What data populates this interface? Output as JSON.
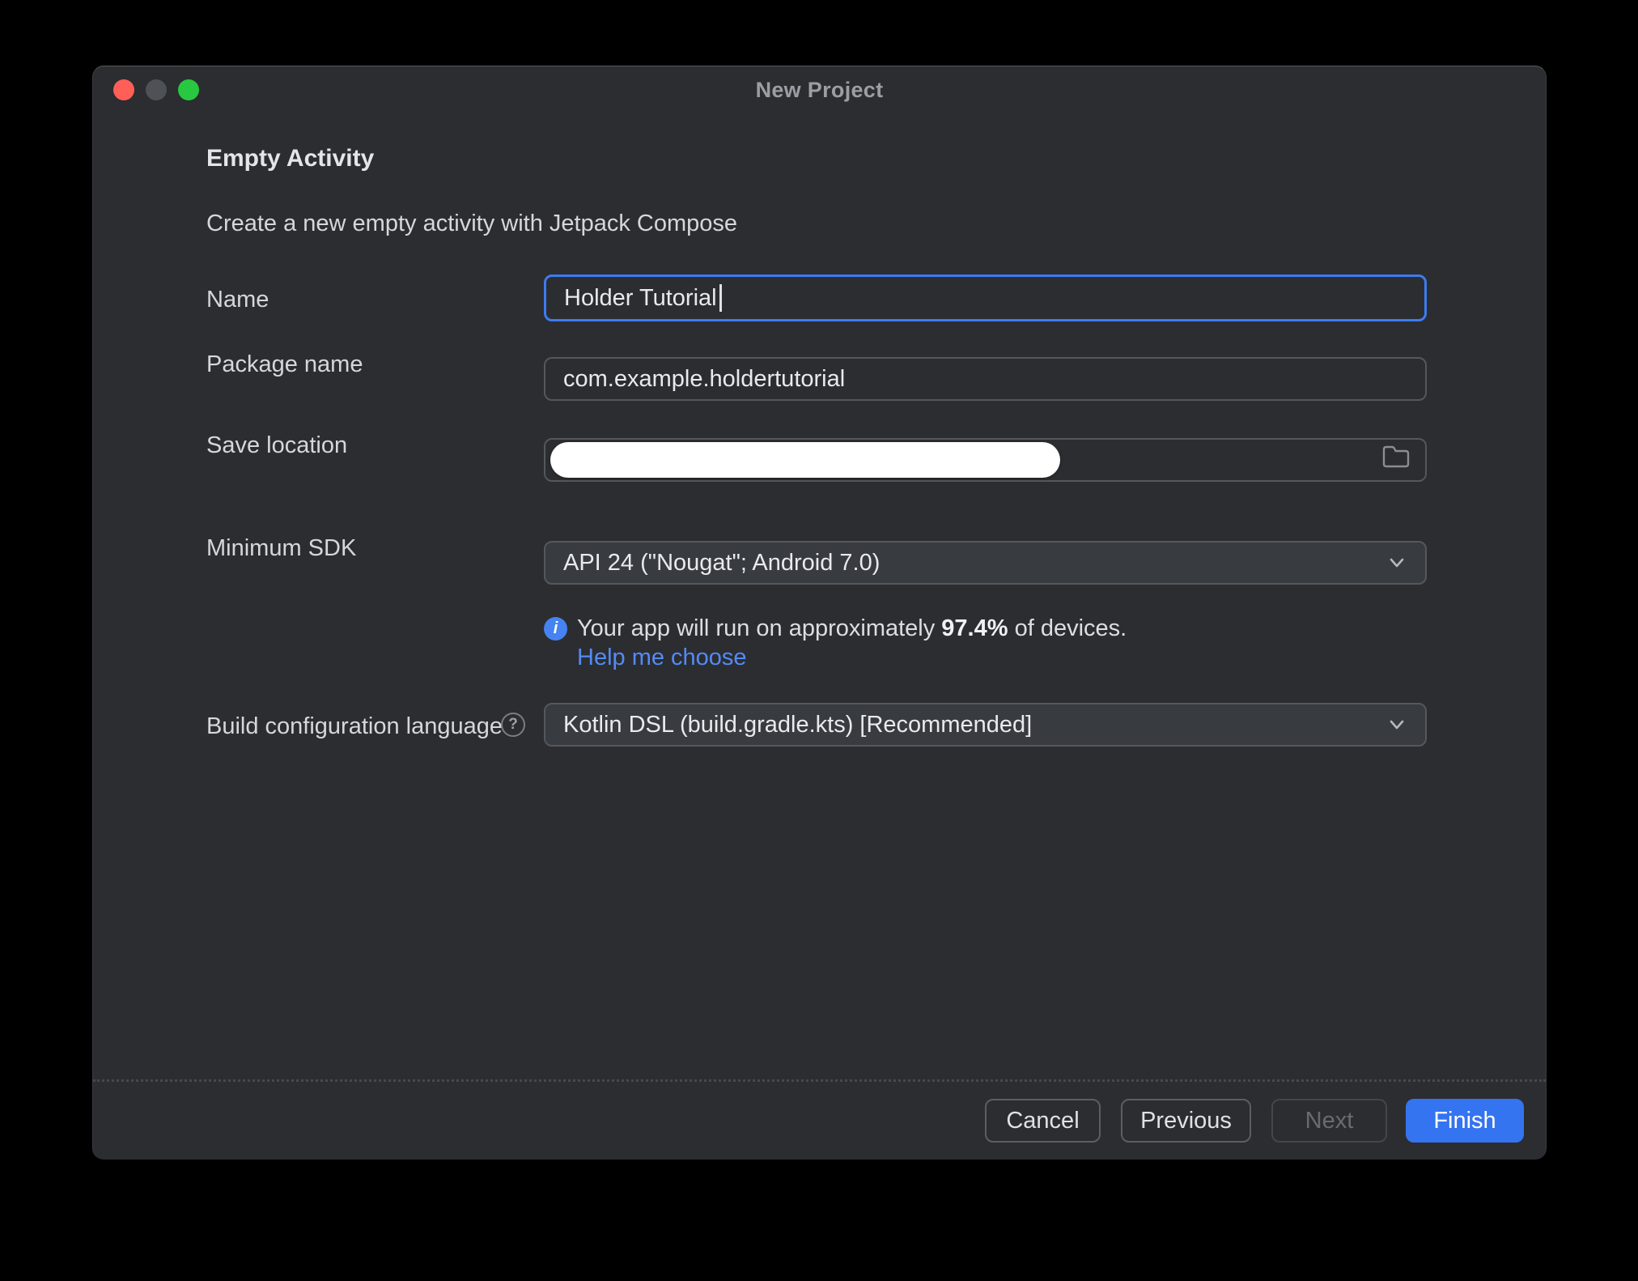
{
  "window": {
    "title": "New Project"
  },
  "content": {
    "heading": "Empty Activity",
    "subtitle": "Create a new empty activity with Jetpack Compose"
  },
  "fields": {
    "name": {
      "label": "Name",
      "value": "Holder Tutorial"
    },
    "package_name": {
      "label": "Package name",
      "value": "com.example.holdertutorial"
    },
    "save_location": {
      "label": "Save location",
      "value": ""
    },
    "minimum_sdk": {
      "label": "Minimum SDK",
      "selected": "API 24 (\"Nougat\"; Android 7.0)"
    },
    "build_config": {
      "label": "Build configuration language",
      "selected": "Kotlin DSL (build.gradle.kts) [Recommended]"
    }
  },
  "sdk_note": {
    "text_prefix": "Your app will run on approximately ",
    "percentage": "97.4%",
    "text_suffix": " of devices.",
    "link": "Help me choose"
  },
  "footer": {
    "cancel": "Cancel",
    "previous": "Previous",
    "next": "Next",
    "finish": "Finish"
  },
  "icons": {
    "info_glyph": "i",
    "help_glyph": "?",
    "folder": "folder-outline",
    "chevron": "chevron-down"
  },
  "colors": {
    "accent_blue": "#3574F0",
    "focus_border": "#3D7BF0",
    "link_blue": "#548AF7",
    "window_bg": "#2B2D30",
    "dropdown_bg": "#383B3F",
    "traffic_close": "#FF5F57",
    "traffic_minimize": "#4E5156",
    "traffic_zoom": "#28C840"
  }
}
